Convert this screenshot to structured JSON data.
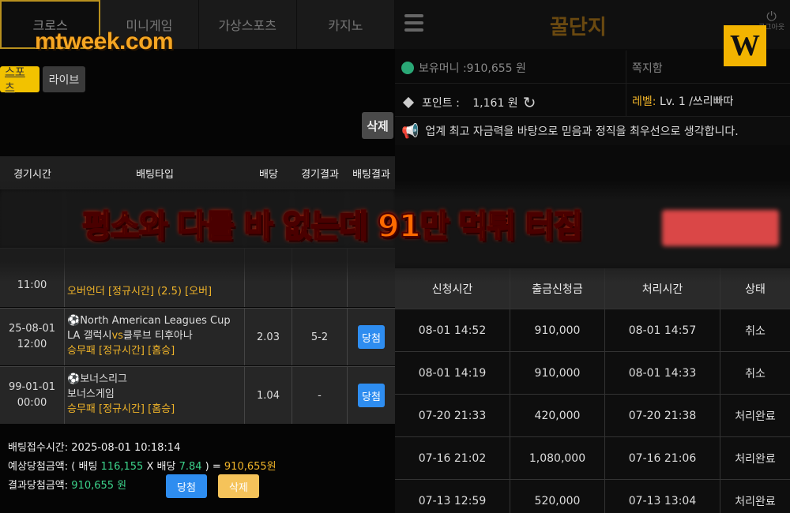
{
  "left": {
    "top_tabs": [
      "크로스",
      "미니게임",
      "가상스포츠",
      "카지노"
    ],
    "site_watermark": "mtweek.com",
    "sub_tabs": [
      "스포츠",
      "라이브"
    ],
    "delete_top": "삭제",
    "table_headers": [
      "경기시간",
      "배팅타입",
      "배당",
      "경기결과",
      "배팅결과"
    ],
    "rows": [
      {
        "time": "",
        "match": "",
        "market": "오버언더 [정규시간] (2.5) [오버]",
        "odds": "",
        "result": "",
        "bet_result": "",
        "time_tail": "11:00"
      },
      {
        "date": "25-08-01",
        "clock": "12:00",
        "league": "North American Leagues Cup",
        "teams_home": "LA 갤럭시",
        "vs": "vs",
        "teams_away": "클루브 티후아나",
        "market": "승무패 [정규시간] [홈승]",
        "odds": "2.03",
        "result": "5-2",
        "bet_result": "당첨"
      },
      {
        "date": "99-01-01",
        "clock": "00:00",
        "league": "보너스리그",
        "teams": "보너스게임",
        "market": "승무패 [정규시간] [홈승]",
        "odds": "1.04",
        "result": "-",
        "bet_result": "당첨"
      }
    ],
    "summary": {
      "receipt_label": "배팅접수시간:",
      "receipt_time": "2025-08-01 10:18:14",
      "expected_label": "예상당첨금액:",
      "expected_open": "( 배팅",
      "stake": "116,155",
      "times": "X 배당",
      "total_odds": "7.84",
      "expected_close": ") =",
      "expected_amount": "910,655원",
      "result_label": "결과당첨금액:",
      "result_amount": "910,655 원",
      "win_button": "당첨",
      "delete_button": "삭제"
    }
  },
  "right": {
    "logo": "꿀단지",
    "logout": "로그아웃",
    "badge": "W",
    "holding_money": "보유머니 :910,655 원",
    "message": "쪽지함",
    "points_label": "포인트 :",
    "points_value": "1,161 원",
    "level_label": "레벨:",
    "level_value": "Lv. 1 /쓰리빠따",
    "notice": "업계 최고 자금력을 바탕으로 믿음과 정직을 최우선으로 생각합니다.",
    "withdraw_headers": [
      "신청시간",
      "출금신청금",
      "처리시간",
      "상태"
    ],
    "withdraw_rows": [
      [
        "08-01 14:52",
        "910,000",
        "08-01 14:57",
        "취소"
      ],
      [
        "08-01 14:19",
        "910,000",
        "08-01 14:33",
        "취소"
      ],
      [
        "07-20 21:33",
        "420,000",
        "07-20 21:38",
        "처리완료"
      ],
      [
        "07-16 21:02",
        "1,080,000",
        "07-16 21:06",
        "처리완료"
      ],
      [
        "07-13 12:59",
        "520,000",
        "07-13 13:04",
        "처리완료"
      ]
    ]
  },
  "overlay": {
    "headline": "평소와 다를 바 없는데 91만 먹튀 터짐",
    "headline_color": "#ff6a00"
  }
}
